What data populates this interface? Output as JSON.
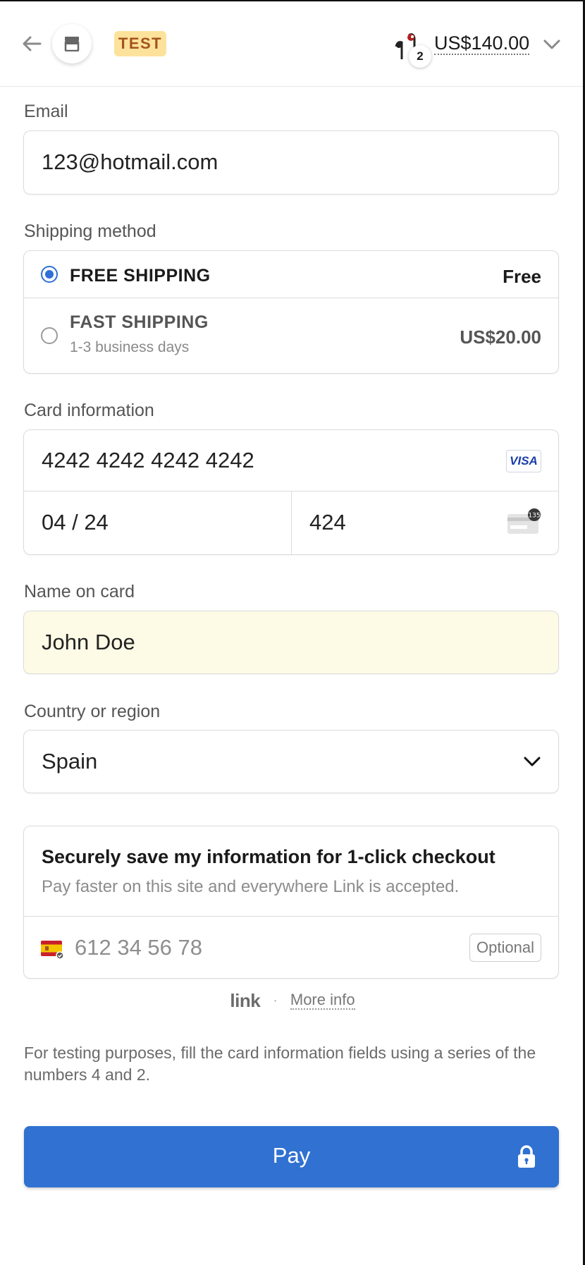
{
  "header": {
    "badge": "TEST",
    "cart_count": "2",
    "total": "US$140.00"
  },
  "email": {
    "label": "Email",
    "value": "123@hotmail.com"
  },
  "shipping": {
    "label": "Shipping method",
    "options": [
      {
        "name": "FREE SHIPPING",
        "price": "Free",
        "selected": true
      },
      {
        "name": "FAST SHIPPING",
        "detail": "1-3 business days",
        "price": "US$20.00",
        "selected": false
      }
    ]
  },
  "card": {
    "label": "Card information",
    "number": "4242 4242 4242 4242",
    "brand": "VISA",
    "expiry": "04 / 24",
    "cvc": "424",
    "cvc_icon_text": "135"
  },
  "name_on_card": {
    "label": "Name on card",
    "value": "John Doe"
  },
  "country": {
    "label": "Country or region",
    "value": "Spain"
  },
  "link": {
    "title": "Securely save my information for 1-click checkout",
    "subtitle": "Pay faster on this site and everywhere Link is accepted.",
    "phone_placeholder": "612 34 56 78",
    "optional": "Optional",
    "logo": "link",
    "separator": "·",
    "more_info": "More info"
  },
  "note": "For testing purposes, fill the card information fields using a series of the numbers 4 and 2.",
  "pay": {
    "label": "Pay"
  },
  "colors": {
    "accent": "#3071d1",
    "test_badge_bg": "#fde29b",
    "autofill_bg": "#fdfbe6"
  }
}
